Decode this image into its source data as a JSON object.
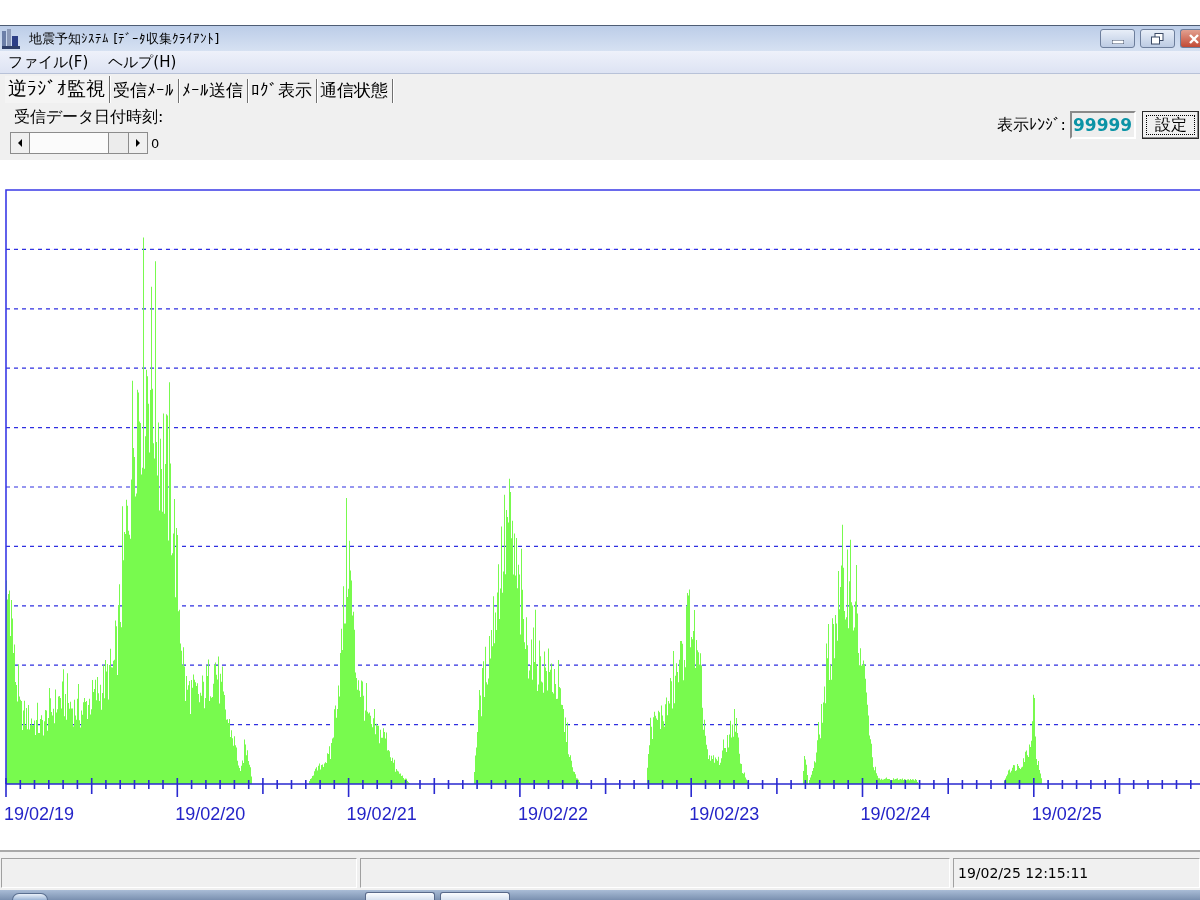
{
  "window": {
    "title": "地震予知ｼｽﾃﾑ [ﾃﾞｰﾀ収集ｸﾗｲｱﾝﾄ]"
  },
  "menu": [
    {
      "label": "ファイル(F)"
    },
    {
      "label": "ヘルプ(H)"
    }
  ],
  "tabs": [
    {
      "label": "逆ﾗｼﾞｵ監視",
      "selected": true
    },
    {
      "label": "受信ﾒｰﾙ",
      "selected": false
    },
    {
      "label": "ﾒｰﾙ送信",
      "selected": false
    },
    {
      "label": "ﾛｸﾞ表示",
      "selected": false
    },
    {
      "label": "通信状態",
      "selected": false
    }
  ],
  "date_selector": {
    "label": "受信データ日付時刻:",
    "value": "0"
  },
  "display_range": {
    "label": "表示ﾚﾝｼﾞ:",
    "value": "99999",
    "button": "設定"
  },
  "chart": {
    "x_labels": [
      "19/02/19",
      "19/02/20",
      "19/02/21",
      "19/02/22",
      "19/02/23",
      "19/02/24",
      "19/02/25"
    ]
  },
  "status_bar": {
    "datetime": "19/02/25 12:15:11"
  }
}
